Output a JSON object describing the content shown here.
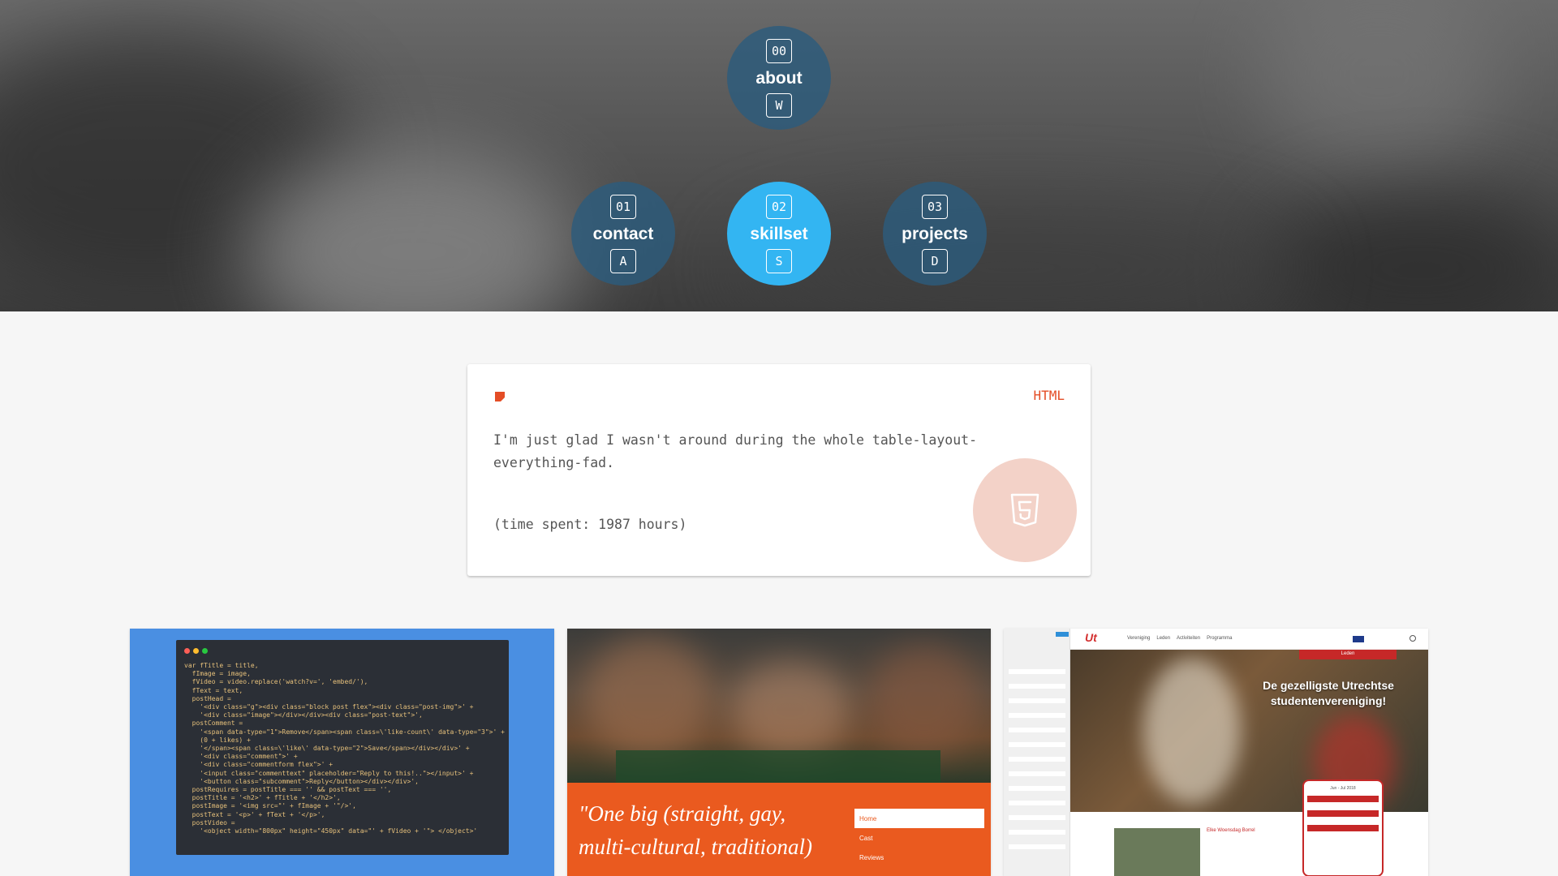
{
  "nav": {
    "items": [
      {
        "number": "00",
        "label": "about",
        "key": "W",
        "active": false
      },
      {
        "number": "01",
        "label": "contact",
        "key": "A",
        "active": false
      },
      {
        "number": "02",
        "label": "skillset",
        "key": "S",
        "active": true
      },
      {
        "number": "03",
        "label": "projects",
        "key": "D",
        "active": false
      }
    ]
  },
  "skill_card": {
    "language": "HTML",
    "description": "I'm just glad I wasn't around during the whole table-layout-everything-fad.",
    "time_spent": "(time spent: 1987 hours)",
    "accent_color": "#e44d26",
    "icon": "html5-icon"
  },
  "projects": {
    "tile1": {
      "code_lines": [
        "var fTitle = title,",
        "  fImage = image,",
        "  fVideo = video.replace('watch?v=', 'embed/'),",
        "  fText = text,",
        "  postHead =",
        "    '<div class=\"g\"><div class=\"block post flex\"><div class=\"post-img\">' +",
        "    '<div class=\"image\"></div></div><div class=\"post-text\">',",
        "  postComment =",
        "    '<span data-type=\"1\">Remove</span><span class=\\'like-count\\' data-type=\"3\">' +",
        "    (0 + likes) +",
        "    '</span><span class=\\'like\\' data-type=\"2\">Save</span></div></div>' +",
        "    '<div class=\"comment\">' +",
        "    '<div class=\"commentform flex\">' +",
        "    '<input class=\"commenttext\" placeholder=\"Reply to this!..\"></input>' +",
        "    '<button class=\"subcomment\">Reply</button></div></div>',",
        "  postRequires = postTitle === '' && postText === '',",
        "  postTitle = '<h2>' + fTitle + '</h2>',",
        "  postImage = '<img src=\"' + fImage + '\"/>',",
        "  postText = '<p>' + fText + '</p>',",
        "  postVideo =",
        "    '<object width=\"800px\" height=\"450px\" data=\"' + fVideo + '\"> </object>'"
      ]
    },
    "tile2": {
      "quote": "\"One big (straight, gay, multi-cultural, traditional)",
      "menu": [
        "Home",
        "Cast",
        "Reviews"
      ]
    },
    "tile3": {
      "headline": "De gezelligste Utrechtse studentenvereniging!",
      "logo_text": "Ut",
      "nav_links": [
        "Vereniging",
        "Leden",
        "Activiteiten",
        "Programma"
      ],
      "button_label": "Leden",
      "subheading": "Elke Woensdag Borrel",
      "calendar_title": "Jun - Jul 2018"
    }
  }
}
